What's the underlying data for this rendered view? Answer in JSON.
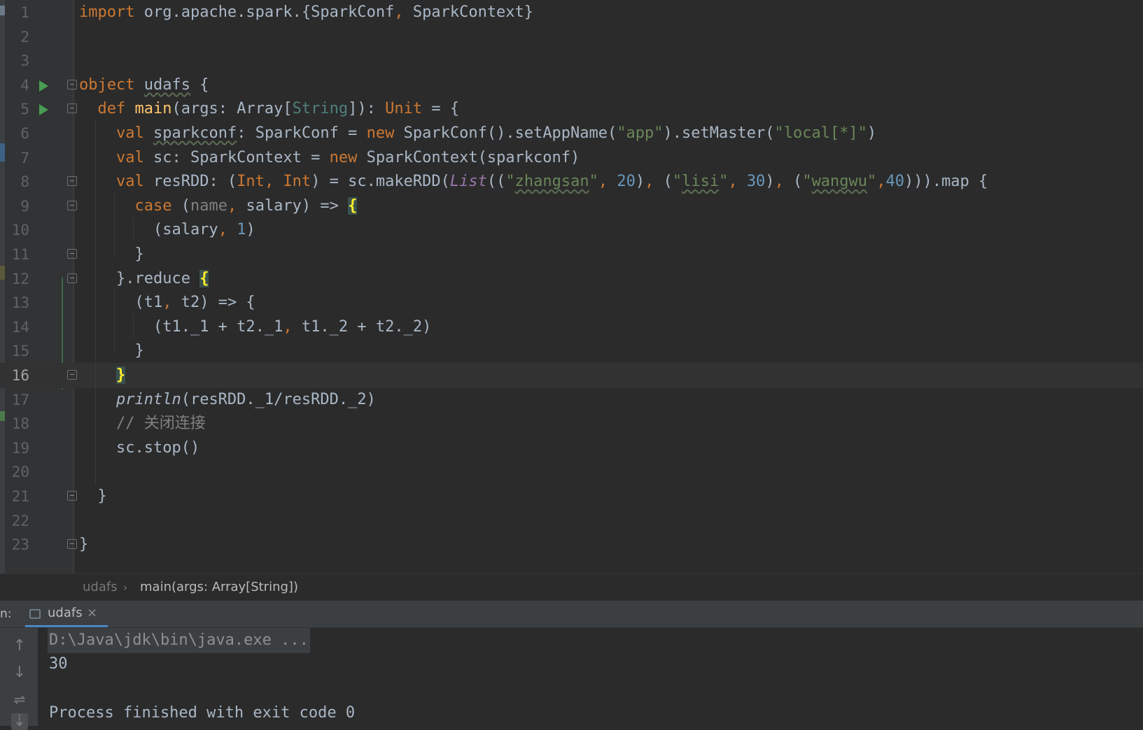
{
  "editor": {
    "current_line": "16",
    "lines": [
      {
        "n": "1",
        "tokens": [
          {
            "t": "import",
            "c": "kw"
          },
          {
            "t": " org.apache.spark.{SparkConf"
          },
          {
            "t": ",",
            "c": "kw"
          },
          {
            "t": " SparkContext}"
          }
        ]
      },
      {
        "n": "2",
        "tokens": []
      },
      {
        "n": "3",
        "tokens": []
      },
      {
        "n": "4",
        "tokens": [
          {
            "t": "object",
            "c": "kw"
          },
          {
            "t": " "
          },
          {
            "t": "udafs",
            "c": "und"
          },
          {
            "t": " {"
          }
        ]
      },
      {
        "n": "5",
        "tokens": [
          {
            "t": "  "
          },
          {
            "t": "def",
            "c": "kw"
          },
          {
            "t": " "
          },
          {
            "t": "main",
            "c": "fn"
          },
          {
            "t": "(args: Array["
          },
          {
            "t": "String",
            "c": "typ"
          },
          {
            "t": "]): "
          },
          {
            "t": "Unit",
            "c": "kw"
          },
          {
            "t": " = {"
          }
        ]
      },
      {
        "n": "6",
        "tokens": [
          {
            "t": "    "
          },
          {
            "t": "val",
            "c": "kw"
          },
          {
            "t": " "
          },
          {
            "t": "sparkconf",
            "c": "und"
          },
          {
            "t": ": SparkConf = "
          },
          {
            "t": "new",
            "c": "kw"
          },
          {
            "t": " SparkConf().setAppName("
          },
          {
            "t": "\"app\"",
            "c": "str"
          },
          {
            "t": ").setMaster("
          },
          {
            "t": "\"local[*]\"",
            "c": "str"
          },
          {
            "t": ")"
          }
        ]
      },
      {
        "n": "7",
        "tokens": [
          {
            "t": "    "
          },
          {
            "t": "val",
            "c": "kw"
          },
          {
            "t": " sc: SparkContext = "
          },
          {
            "t": "new",
            "c": "kw"
          },
          {
            "t": " SparkContext(sparkconf)"
          }
        ]
      },
      {
        "n": "8",
        "tokens": [
          {
            "t": "    "
          },
          {
            "t": "val",
            "c": "kw"
          },
          {
            "t": " resRDD: ("
          },
          {
            "t": "Int",
            "c": "kw"
          },
          {
            "t": ",",
            "c": "kw"
          },
          {
            "t": " "
          },
          {
            "t": "Int",
            "c": "kw"
          },
          {
            "t": ") = sc.makeRDD("
          },
          {
            "t": "List",
            "c": "it"
          },
          {
            "t": "(("
          },
          {
            "t": "\"",
            "c": "str"
          },
          {
            "t": "zhangsan",
            "c": "str und"
          },
          {
            "t": "\"",
            "c": "str"
          },
          {
            "t": ",",
            "c": "kw"
          },
          {
            "t": " "
          },
          {
            "t": "20",
            "c": "num"
          },
          {
            "t": ")"
          },
          {
            "t": ",",
            "c": "kw"
          },
          {
            "t": " ("
          },
          {
            "t": "\"",
            "c": "str"
          },
          {
            "t": "lisi",
            "c": "str und"
          },
          {
            "t": "\"",
            "c": "str"
          },
          {
            "t": ",",
            "c": "kw"
          },
          {
            "t": " "
          },
          {
            "t": "30",
            "c": "num"
          },
          {
            "t": ")"
          },
          {
            "t": ",",
            "c": "kw"
          },
          {
            "t": " ("
          },
          {
            "t": "\"",
            "c": "str"
          },
          {
            "t": "wangwu",
            "c": "str und"
          },
          {
            "t": "\"",
            "c": "str"
          },
          {
            "t": ",",
            "c": "kw"
          },
          {
            "t": "40",
            "c": "num"
          },
          {
            "t": "))).map {"
          }
        ]
      },
      {
        "n": "9",
        "tokens": [
          {
            "t": "      "
          },
          {
            "t": "case",
            "c": "kw"
          },
          {
            "t": " ("
          },
          {
            "t": "name",
            "c": "gray"
          },
          {
            "t": ",",
            "c": "kw"
          },
          {
            "t": " salary) => "
          },
          {
            "t": "{",
            "c": "brace-hl"
          }
        ]
      },
      {
        "n": "10",
        "tokens": [
          {
            "t": "        (salary"
          },
          {
            "t": ",",
            "c": "kw"
          },
          {
            "t": " "
          },
          {
            "t": "1",
            "c": "num"
          },
          {
            "t": ")"
          }
        ]
      },
      {
        "n": "11",
        "tokens": [
          {
            "t": "      }"
          }
        ]
      },
      {
        "n": "12",
        "tokens": [
          {
            "t": "    }.reduce "
          },
          {
            "t": "{",
            "c": "brace-hl"
          }
        ]
      },
      {
        "n": "13",
        "tokens": [
          {
            "t": "      (t1"
          },
          {
            "t": ",",
            "c": "kw"
          },
          {
            "t": " t2) => {"
          }
        ]
      },
      {
        "n": "14",
        "tokens": [
          {
            "t": "        (t1._1 + t2._1"
          },
          {
            "t": ",",
            "c": "kw"
          },
          {
            "t": " t1._2 + t2._2)"
          }
        ]
      },
      {
        "n": "15",
        "tokens": [
          {
            "t": "      }"
          }
        ]
      },
      {
        "n": "16",
        "tokens": [
          {
            "t": "    "
          },
          {
            "t": "}",
            "c": "brace-hl"
          }
        ]
      },
      {
        "n": "17",
        "tokens": [
          {
            "t": "    "
          },
          {
            "t": "println",
            "c": "itw"
          },
          {
            "t": "(resRDD._1/resRDD._2)"
          }
        ]
      },
      {
        "n": "18",
        "tokens": [
          {
            "t": "    "
          },
          {
            "t": "// 关闭连接",
            "c": "cm"
          }
        ]
      },
      {
        "n": "19",
        "tokens": [
          {
            "t": "    sc.stop()"
          }
        ]
      },
      {
        "n": "20",
        "tokens": []
      },
      {
        "n": "21",
        "tokens": [
          {
            "t": "  }"
          }
        ]
      },
      {
        "n": "22",
        "tokens": []
      },
      {
        "n": "23",
        "tokens": [
          {
            "t": "}"
          }
        ]
      }
    ]
  },
  "breadcrumb": {
    "object": "udafs",
    "separator": "›",
    "method": "main(args: Array[String])"
  },
  "run_panel": {
    "label": "n:",
    "tab_label": "udafs",
    "tab_close": "×",
    "toolbar_icons": [
      "arrow-up-icon",
      "arrow-down-icon",
      "soft-wrap-icon",
      "scroll-to-end-icon"
    ],
    "output": {
      "command": "D:\\Java\\jdk\\bin\\java.exe ...",
      "result": "30",
      "exit_message": "Process finished with exit code 0"
    }
  },
  "colors": {
    "keyword": "#cc7832",
    "string": "#6a8759",
    "number": "#6897bb",
    "function": "#ffc66d",
    "run_arrow": "#499c54",
    "tab_underline": "#4a88c7"
  }
}
